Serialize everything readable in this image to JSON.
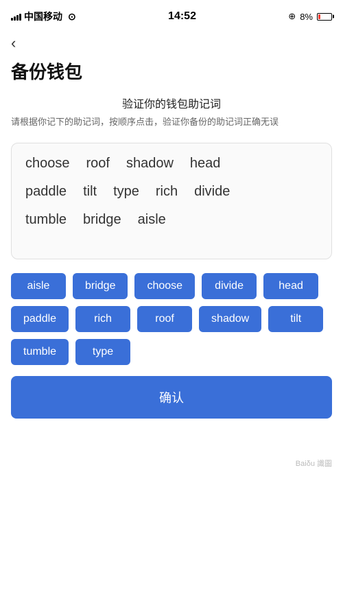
{
  "statusBar": {
    "carrier": "中国移动",
    "time": "14:52",
    "batteryPercent": "8%",
    "batteryColor": "#ff3b30"
  },
  "backButton": {
    "label": "‹"
  },
  "pageTitle": "备份钱包",
  "instruction": {
    "title": "验证你的钱包助记词",
    "desc": "请根据你记下的助记词，按顺序点击，验证你备份的助记词正确无误"
  },
  "displayWords": [
    "choose",
    "roof",
    "shadow",
    "head",
    "paddle",
    "tilt",
    "type",
    "rich",
    "divide",
    "tumble",
    "bridge",
    "aisle"
  ],
  "displayRows": [
    [
      "choose",
      "roof",
      "shadow",
      "head"
    ],
    [
      "paddle",
      "tilt",
      "type",
      "rich",
      "divide"
    ],
    [
      "tumble",
      "bridge",
      "aisle"
    ]
  ],
  "wordChips": [
    "aisle",
    "bridge",
    "choose",
    "divide",
    "head",
    "paddle",
    "rich",
    "roof",
    "shadow",
    "tilt",
    "tumble",
    "type"
  ],
  "confirmButton": {
    "label": "确认"
  },
  "watermark": "Baiδu 識圖"
}
